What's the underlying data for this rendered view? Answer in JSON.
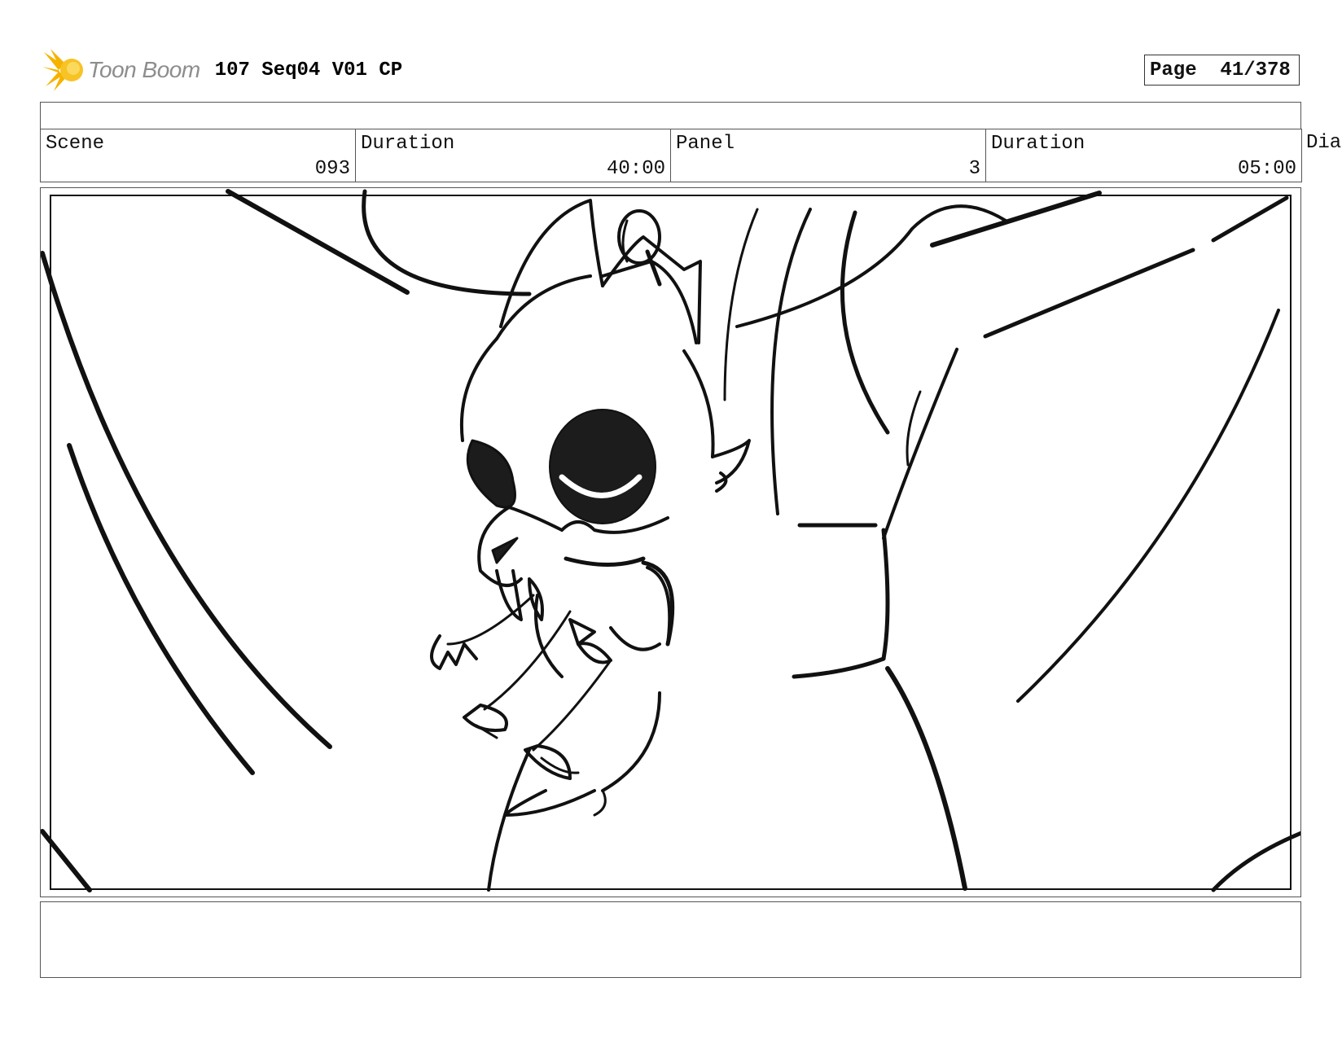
{
  "header": {
    "logo_text": "Toon Boom",
    "doc_title": "107 Seq04 V01 CP",
    "page_label": "Page",
    "page_value": "41/378"
  },
  "info": {
    "scene_label": "Scene",
    "scene_value": "093",
    "duration_label": "Duration",
    "duration_value": "40:00",
    "panel_label": "Panel",
    "panel_value": "3",
    "panel_duration_label": "Duration",
    "panel_duration_value": "05:00",
    "dialogue_label": "Dia"
  },
  "colors": {
    "logo_yellow": "#f5b300",
    "logo_text_gray": "#8d8d8d",
    "ink": "#111111"
  },
  "notes": {
    "text": ""
  }
}
